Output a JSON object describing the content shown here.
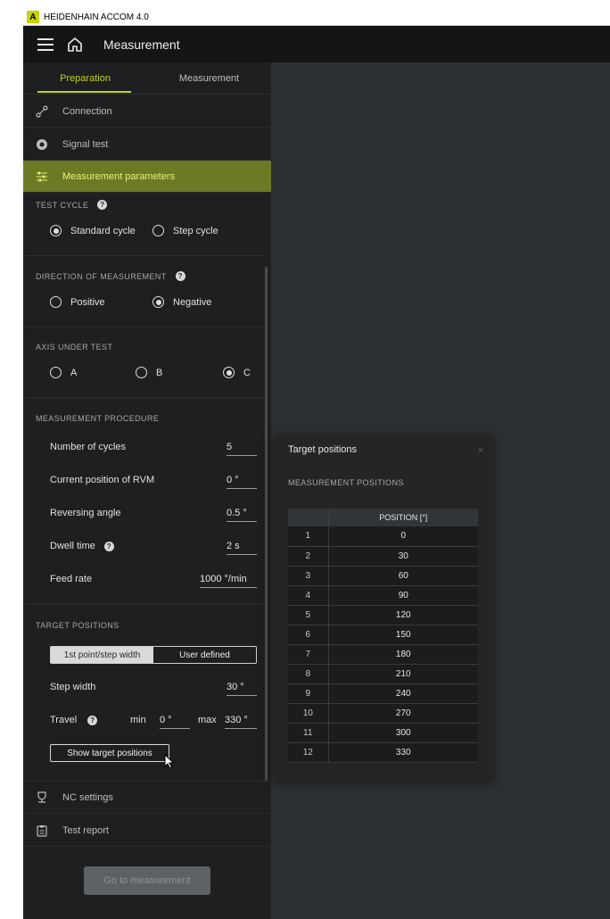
{
  "window": {
    "logo_letter": "A",
    "title": "HEIDENHAIN ACCOM 4.0"
  },
  "header": {
    "title": "Measurement"
  },
  "tabs": [
    {
      "label": "Preparation",
      "active": true
    },
    {
      "label": "Measurement",
      "active": false
    }
  ],
  "nav": {
    "connection": "Connection",
    "signal_test": "Signal test",
    "measurement_parameters": "Measurement parameters",
    "nc_settings": "NC settings",
    "test_report": "Test report"
  },
  "test_cycle": {
    "title": "TEST CYCLE",
    "options": [
      "Standard cycle",
      "Step cycle"
    ],
    "selected": "Standard cycle"
  },
  "direction": {
    "title": "DIRECTION OF MEASUREMENT",
    "options": [
      "Positive",
      "Negative"
    ],
    "selected": "Negative"
  },
  "axis": {
    "title": "AXIS UNDER TEST",
    "options": [
      "A",
      "B",
      "C"
    ],
    "selected": "C"
  },
  "procedure": {
    "title": "MEASUREMENT PROCEDURE",
    "cycles_label": "Number of cycles",
    "cycles_value": "5",
    "rvm_label": "Current position of RVM",
    "rvm_value": "0 °",
    "reversing_label": "Reversing angle",
    "reversing_value": "0.5 °",
    "dwell_label": "Dwell time",
    "dwell_value": "2 s",
    "feed_label": "Feed rate",
    "feed_value": "1000 °/min"
  },
  "target": {
    "title": "TARGET POSITIONS",
    "mode_options": [
      "1st point/step width",
      "User defined"
    ],
    "mode_selected": "1st point/step width",
    "step_label": "Step width",
    "step_value": "30 °",
    "travel_label": "Travel",
    "min_label": "min",
    "min_value": "0 °",
    "max_label": "max",
    "max_value": "330 °",
    "show_button": "Show target positions"
  },
  "go_button": "Go to measurement",
  "popup": {
    "title": "Target positions",
    "close": "×",
    "subtitle": "MEASUREMENT POSITIONS",
    "column_header": "POSITION [°]",
    "rows": [
      {
        "idx": "1",
        "pos": "0"
      },
      {
        "idx": "2",
        "pos": "30"
      },
      {
        "idx": "3",
        "pos": "60"
      },
      {
        "idx": "4",
        "pos": "90"
      },
      {
        "idx": "5",
        "pos": "120"
      },
      {
        "idx": "6",
        "pos": "150"
      },
      {
        "idx": "7",
        "pos": "180"
      },
      {
        "idx": "8",
        "pos": "210"
      },
      {
        "idx": "9",
        "pos": "240"
      },
      {
        "idx": "10",
        "pos": "270"
      },
      {
        "idx": "11",
        "pos": "300"
      },
      {
        "idx": "12",
        "pos": "330"
      }
    ]
  },
  "colors": {
    "accent": "#c3d21a",
    "active_nav_bg": "#6d7a25",
    "panel_bg": "#1d1f20",
    "app_bg": "#2d3032"
  }
}
